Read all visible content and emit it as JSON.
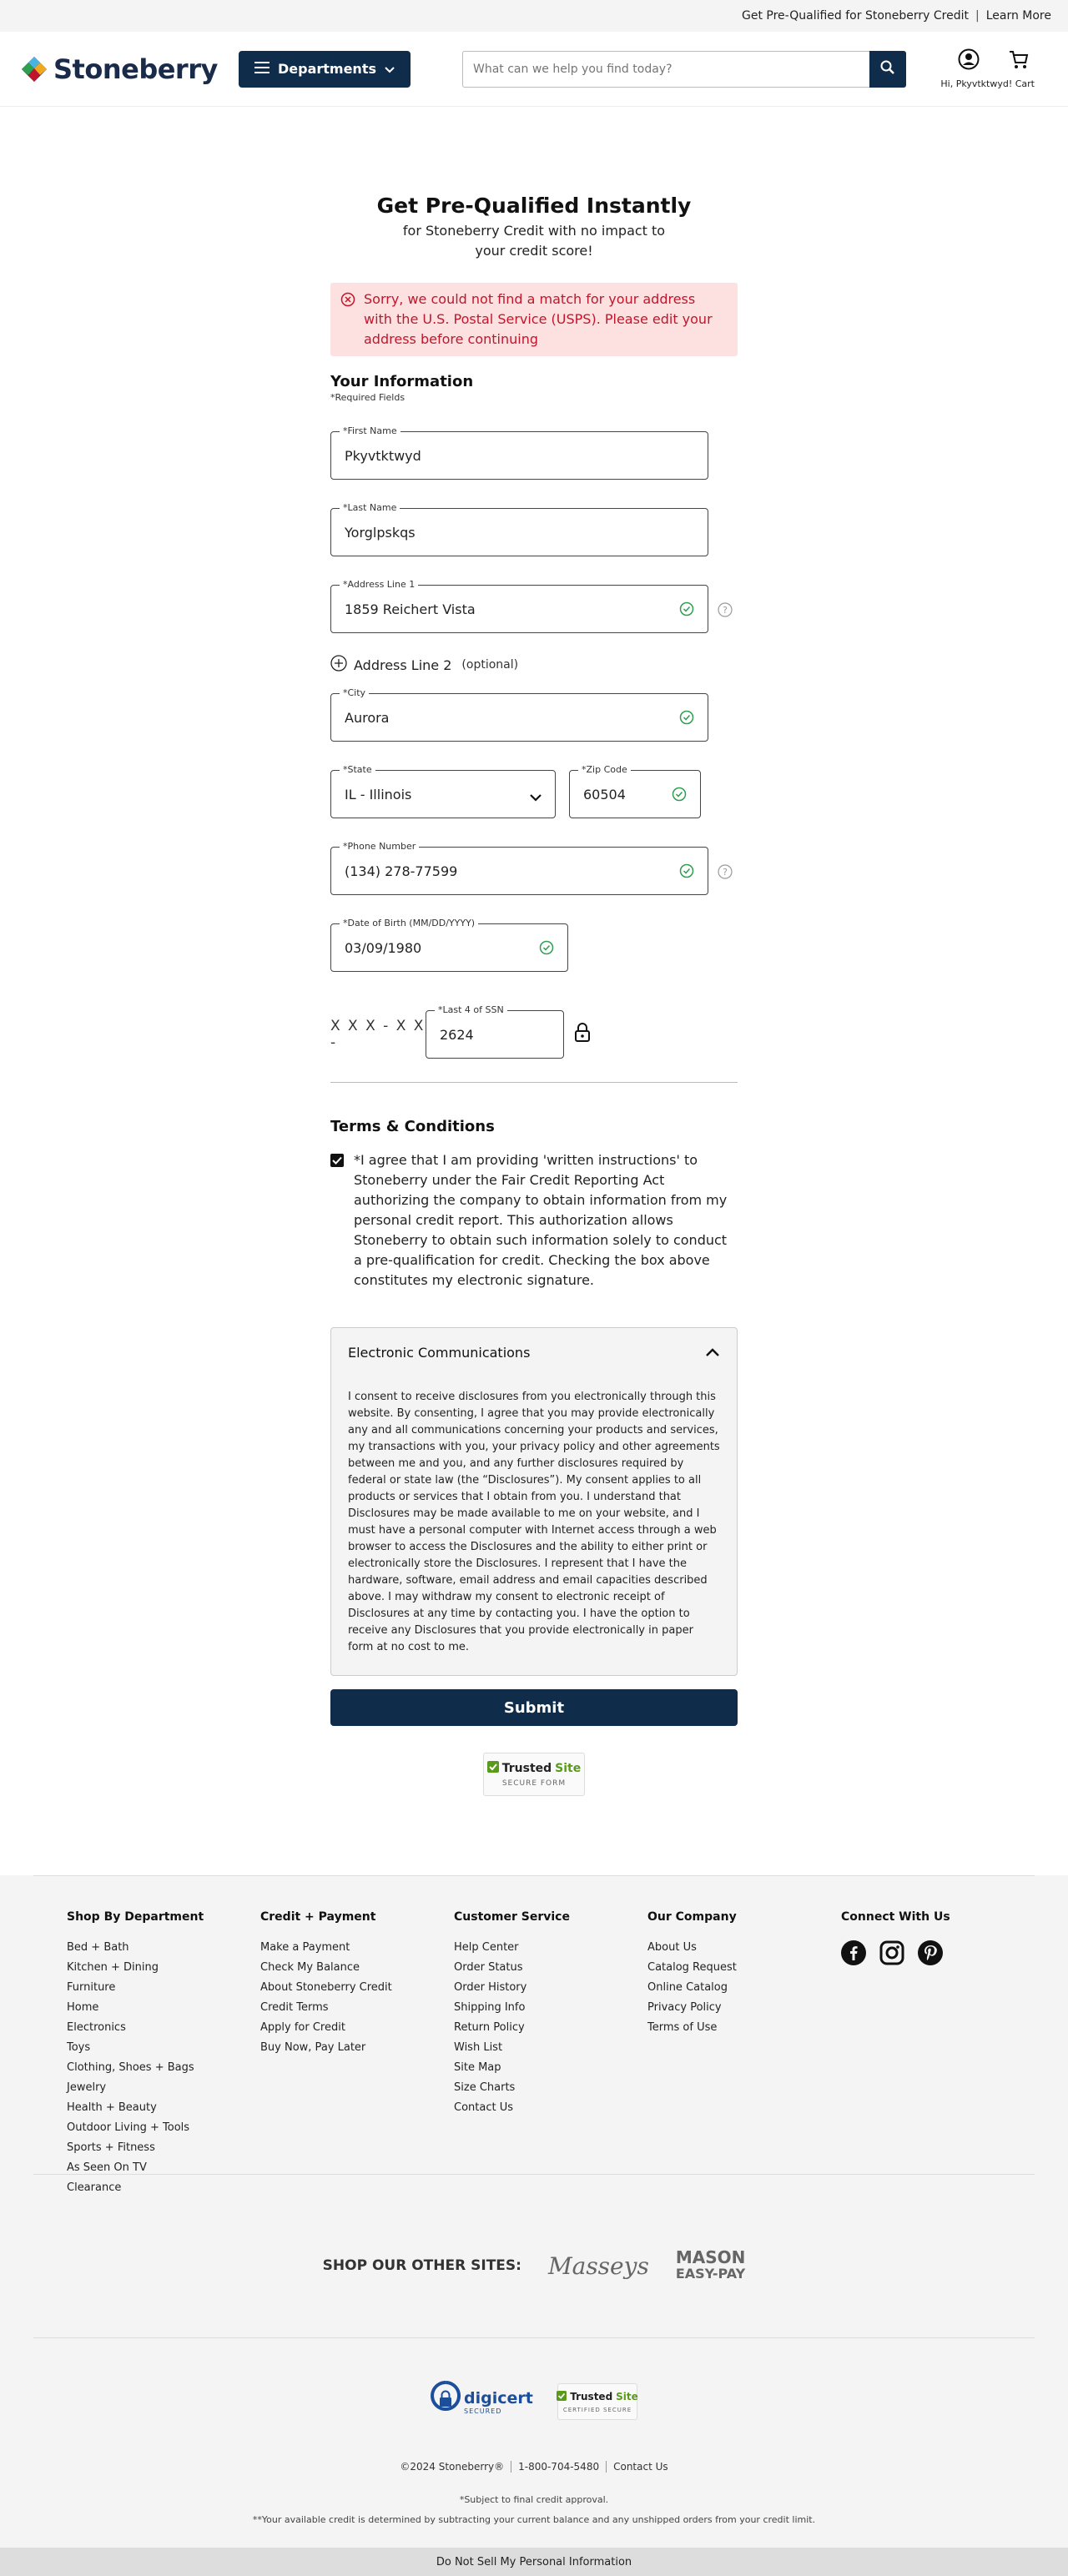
{
  "topbar": {
    "promo": "Get Pre-Qualified for Stoneberry Credit",
    "separator": "|",
    "learn_more": "Learn More"
  },
  "header": {
    "logo_text": "Stoneberry",
    "departments_label": "Departments",
    "search_placeholder": "What can we help you find today?",
    "account_text": "Hi, Pkyvtktwyd! Cart"
  },
  "form": {
    "title": "Get Pre-Qualified Instantly",
    "subtitle": "for Stoneberry Credit with no impact to your credit score!",
    "error": "Sorry, we could not find a match for your address with the U.S. Postal Service (USPS). Please edit your address before continuing",
    "section_title": "Your Information",
    "required_note": "*Required Fields",
    "first_name": {
      "label": "*First Name",
      "value": "Pkyvtktwyd"
    },
    "last_name": {
      "label": "*Last Name",
      "value": "Yorglpskqs"
    },
    "address1": {
      "label": "*Address Line 1",
      "value": "1859 Reichert Vista"
    },
    "address2": {
      "label": "Address Line 2",
      "optional": "(optional)"
    },
    "city": {
      "label": "*City",
      "value": "Aurora"
    },
    "state": {
      "label": "*State",
      "value": "IL - Illinois"
    },
    "zip": {
      "label": "*Zip Code",
      "value": "60504"
    },
    "phone": {
      "label": "*Phone Number",
      "value": "(134) 278-77599"
    },
    "dob": {
      "label": "*Date of Birth (MM/DD/YYYY)",
      "value": "03/09/1980"
    },
    "ssn_prefix": "X X X - X X -",
    "ssn": {
      "label": "*Last 4 of SSN",
      "value": "2624"
    },
    "terms_title": "Terms & Conditions",
    "terms_text": "*I agree that I am providing 'written instructions' to Stoneberry under the Fair Credit Reporting Act authorizing the company to obtain information from my personal credit report. This authorization allows Stoneberry to obtain such information solely to conduct a pre-qualification for credit. Checking the box above constitutes my electronic signature.",
    "terms_checked": true,
    "ec_title": "Electronic Communications",
    "ec_text": "I consent to receive disclosures from you electronically through this website. By consenting, I agree that you may provide electronically any and all communications concerning your products and services, my transactions with you, your privacy policy and other agreements between me and you, and any further disclosures required by federal or state law (the “Disclosures”). My consent applies to all products or services that I obtain from you. I understand that Disclosures may be made available to me on your website, and I must have a personal computer with Internet access through a web browser to access the Disclosures and the ability to either print or electronically store the Disclosures. I represent that I have the hardware, software, email address and email capacities described above. I may withdraw my consent to electronic receipt of Disclosures at any time by contacting you. I have the option to receive any Disclosures that you provide electronically in paper form at no cost to me.",
    "submit_label": "Submit",
    "trusted": {
      "name": "Trusted",
      "site": "Site",
      "sub": "SECURE FORM"
    }
  },
  "footer": {
    "columns": [
      {
        "title": "Shop By Department",
        "links": [
          "Bed + Bath",
          "Kitchen + Dining",
          "Furniture",
          "Home",
          "Electronics",
          "Toys",
          "Clothing, Shoes + Bags",
          "Jewelry",
          "Health + Beauty",
          "Outdoor Living + Tools",
          "Sports + Fitness",
          "As Seen On TV",
          "Clearance"
        ]
      },
      {
        "title": "Credit + Payment",
        "links": [
          "Make a Payment",
          "Check My Balance",
          "About Stoneberry Credit",
          "Credit Terms",
          "Apply for Credit",
          "Buy Now, Pay Later"
        ]
      },
      {
        "title": "Customer Service",
        "links": [
          "Help Center",
          "Order Status",
          "Order History",
          "Shipping Info",
          "Return Policy",
          "Wish List",
          "Site Map",
          "Size Charts",
          "Contact Us"
        ]
      },
      {
        "title": "Our Company",
        "links": [
          "About Us",
          "Catalog Request",
          "Online Catalog",
          "Privacy Policy",
          "Terms of Use"
        ]
      }
    ],
    "connect_title": "Connect With Us",
    "other_sites_label": "SHOP OUR OTHER SITES:",
    "masseys": "Masseys",
    "mason_top": "MASON",
    "mason_bottom": "EASY-PAY",
    "digicert": "digicert",
    "digicert_sub": "SECURED",
    "trusted_name": "Trusted",
    "trusted_site": "Site",
    "trusted_sub": "CERTIFIED SECURE",
    "copyright": "©2024 Stoneberry®",
    "phone": "1-800-704-5480",
    "contact": "Contact Us",
    "note1": "*Subject to final credit approval.",
    "note2": "**Your available credit is determined by subtracting your current balance and any unshipped orders from your credit limit.",
    "dns": "Do Not Sell My Personal Information"
  },
  "colors": {
    "navy": "#0f2d4b",
    "error_bg": "#fde0e0",
    "error_text": "#c0162c",
    "valid_green": "#2e9e4f"
  }
}
